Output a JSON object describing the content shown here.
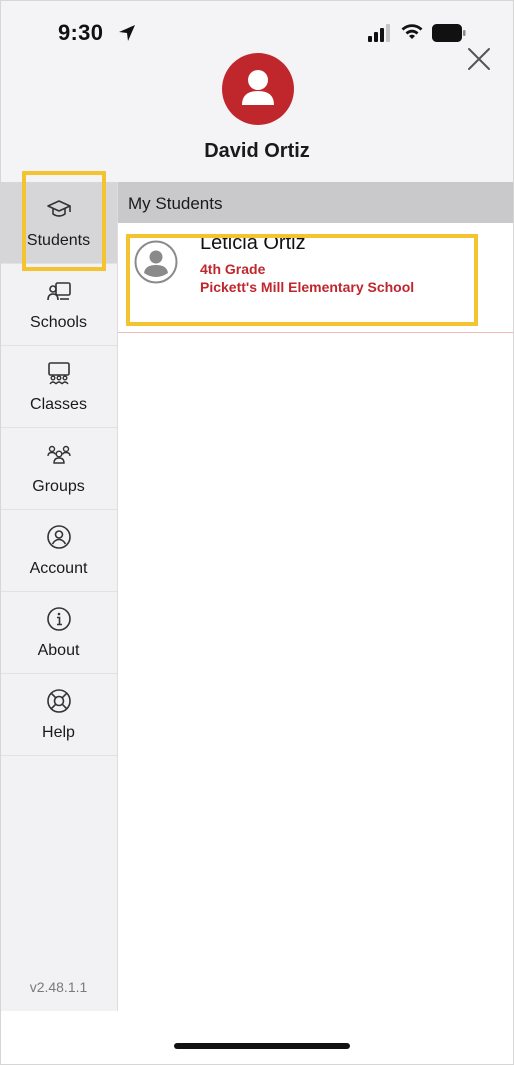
{
  "status_bar": {
    "time": "9:30"
  },
  "profile": {
    "name": "David Ortiz"
  },
  "sidebar": {
    "items": [
      {
        "label": "Students",
        "icon": "graduation-cap-icon",
        "active": true
      },
      {
        "label": "Schools",
        "icon": "school-icon",
        "active": false
      },
      {
        "label": "Classes",
        "icon": "classroom-icon",
        "active": false
      },
      {
        "label": "Groups",
        "icon": "group-icon",
        "active": false
      },
      {
        "label": "Account",
        "icon": "account-icon",
        "active": false
      },
      {
        "label": "About",
        "icon": "info-icon",
        "active": false
      },
      {
        "label": "Help",
        "icon": "help-lifebuoy-icon",
        "active": false
      }
    ],
    "version": "v2.48.1.1"
  },
  "main": {
    "section_title": "My Students",
    "students": [
      {
        "name": "Leticia Ortiz",
        "grade": "4th Grade",
        "school": "Pickett's Mill Elementary School"
      }
    ]
  },
  "colors": {
    "accent": "#c0272d",
    "highlight": "#f4c430",
    "sidebar_bg": "#f2f2f4",
    "active_bg": "#d6d6d8"
  }
}
